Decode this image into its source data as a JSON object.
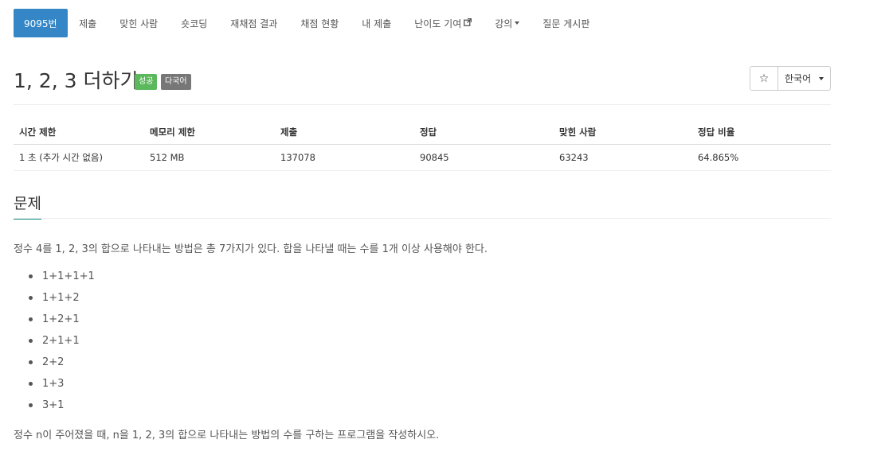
{
  "nav": {
    "tabs": [
      {
        "label": "9095번",
        "active": true
      },
      {
        "label": "제출"
      },
      {
        "label": "맞힌 사람"
      },
      {
        "label": "숏코딩"
      },
      {
        "label": "재채점 결과"
      },
      {
        "label": "채점 현황"
      },
      {
        "label": "내 제출"
      },
      {
        "label": "난이도 기여",
        "icon": "external-link-icon"
      },
      {
        "label": "강의",
        "icon": "caret-down-icon"
      },
      {
        "label": "질문 게시판"
      }
    ]
  },
  "problem": {
    "title": "1, 2, 3 더하기",
    "badge_success": "성공",
    "badge_multilang": "다국어",
    "star_icon": "☆",
    "language": "한국어"
  },
  "info": {
    "headers": [
      "시간 제한",
      "메모리 제한",
      "제출",
      "정답",
      "맞힌 사람",
      "정답 비율"
    ],
    "values": [
      "1 초 (추가 시간 없음)",
      "512 MB",
      "137078",
      "90845",
      "63243",
      "64.865%"
    ]
  },
  "section": {
    "title": "문제",
    "intro": "정수 4를 1, 2, 3의 합으로 나타내는 방법은 총 7가지가 있다. 합을 나타낼 때는 수를 1개 이상 사용해야 한다.",
    "examples": [
      "1+1+1+1",
      "1+1+2",
      "1+2+1",
      "2+1+1",
      "2+2",
      "1+3",
      "3+1"
    ],
    "task": "정수 n이 주어졌을 때, n을 1, 2, 3의 합으로 나타내는 방법의 수를 구하는 프로그램을 작성하시오."
  },
  "colors": {
    "active_tab": "#3486c6",
    "success_badge": "#5cb85c",
    "multilang_badge": "#777777",
    "section_underline": "#0f8d84"
  }
}
